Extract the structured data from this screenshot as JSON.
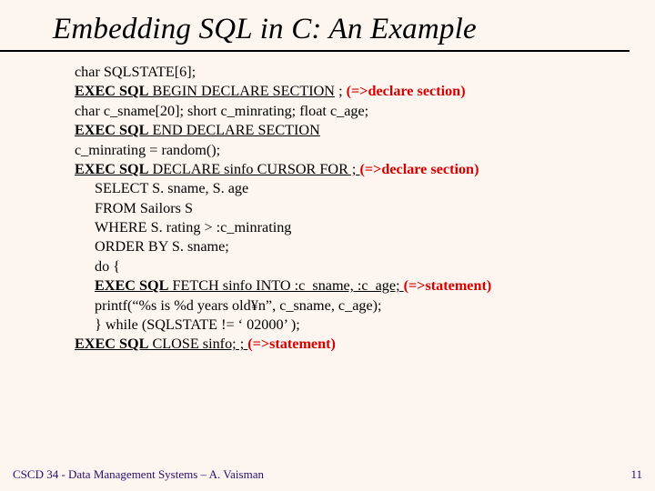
{
  "title": "Embedding SQL in C: An Example",
  "code": {
    "l1": "char SQLSTATE[6];",
    "exec": "EXEC SQL",
    "l2b": " BEGIN DECLARE SECTION",
    "l2c": " ; ",
    "ann1": "(=>declare section)",
    "l3": "char c_sname[20]; short c_minrating; float c_age;",
    "l4b": " END DECLARE SECTION",
    "l5": "c_minrating = random();",
    "l6b": " DECLARE sinfo CURSOR FOR ; ",
    "l7": "SELECT S. sname, S. age",
    "l8": "FROM Sailors S",
    "l9": "WHERE S. rating > :c_minrating",
    "l10": "ORDER BY S. sname;",
    "l11": "do {",
    "l12b": " FETCH sinfo INTO :c_sname, :c_age; ",
    "ann2": "(=>statement)",
    "l13": "printf(“%s is %d years old¥n”, c_sname, c_age);",
    "l14": "} while (SQLSTATE != ‘ 02000’ );",
    "l15b": " CLOSE sinfo; ; "
  },
  "footer": {
    "left": "CSCD 34 - Data Management Systems – A. Vaisman",
    "page": "11"
  }
}
